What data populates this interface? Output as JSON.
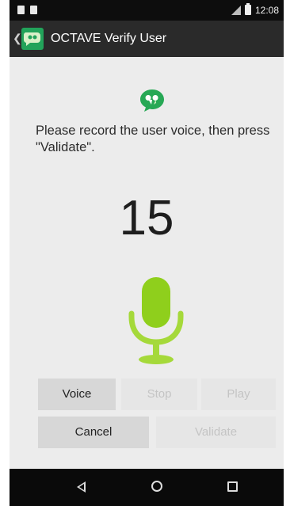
{
  "status_bar": {
    "time": "12:08"
  },
  "action_bar": {
    "title": "OCTAVE Verify User"
  },
  "content": {
    "instruction": "Please record the user voice, then press \"Validate\".",
    "counter": "15"
  },
  "buttons": {
    "voice": "Voice",
    "stop": "Stop",
    "play": "Play",
    "cancel": "Cancel",
    "validate": "Validate"
  },
  "colors": {
    "accent_green": "#8fcf1c",
    "app_icon_green": "#22a35a"
  },
  "icons": [
    "speech-bubble-icon",
    "microphone-icon",
    "back-icon",
    "home-icon",
    "recents-icon"
  ]
}
